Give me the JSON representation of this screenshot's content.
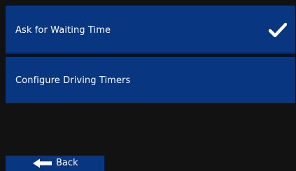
{
  "menu": {
    "items": [
      {
        "label": "Ask for Waiting Time",
        "checked": true,
        "check_icon": "checkmark-icon"
      },
      {
        "label": "Configure Driving Timers",
        "checked": false
      }
    ]
  },
  "footer": {
    "back_label": "Back",
    "back_icon": "left-arrow-icon"
  },
  "colors": {
    "panel": "#093681",
    "background": "#121212",
    "text": "#ffffff"
  }
}
